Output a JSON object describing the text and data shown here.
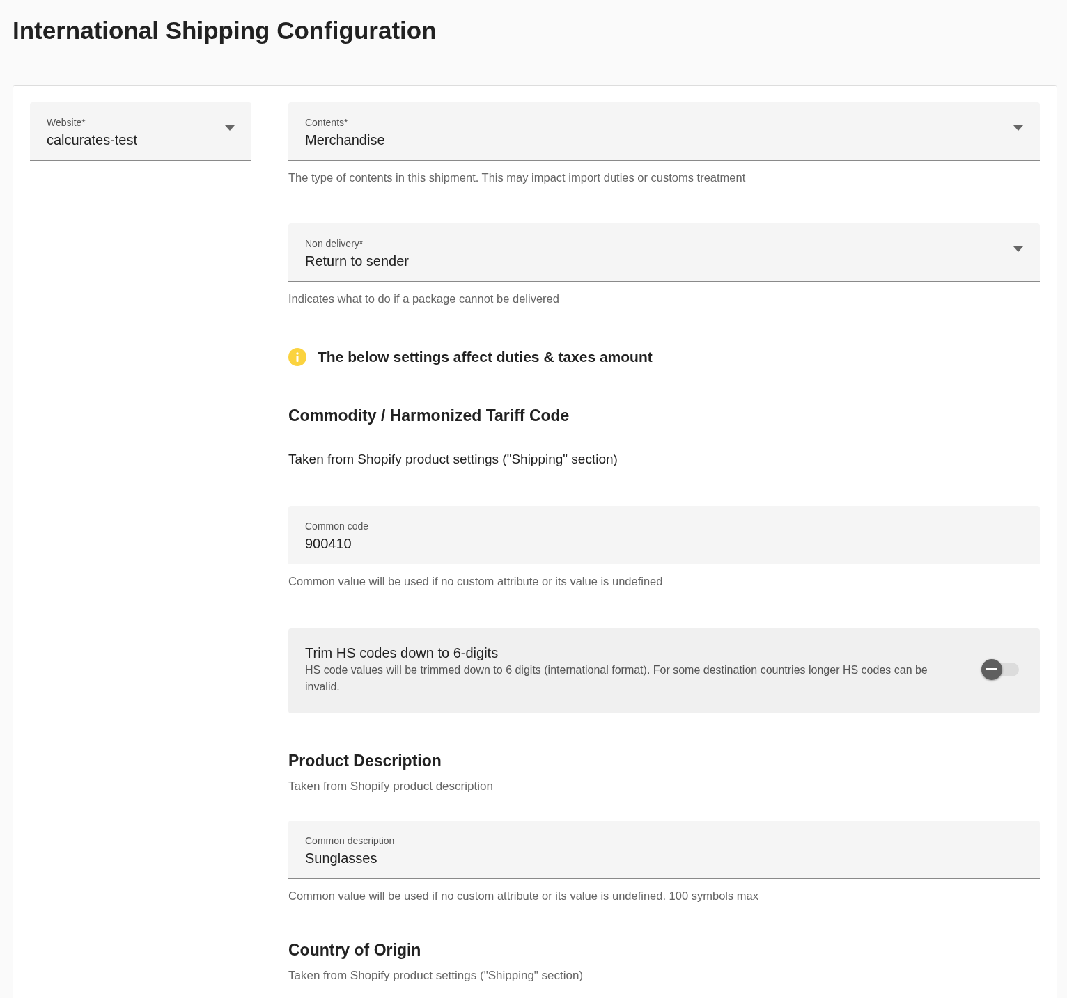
{
  "page": {
    "title": "International Shipping Configuration"
  },
  "website": {
    "label": "Website*",
    "value": "calcurates-test"
  },
  "items": [
    {
      "kind": "select",
      "label": "Contents*",
      "value": "Merchandise",
      "helper": "The type of contents in this shipment. This may impact import duties or customs treatment"
    },
    {
      "kind": "select",
      "label": "Non delivery*",
      "value": "Return to sender",
      "helper": "Indicates what to do if a package cannot be delivered"
    },
    {
      "kind": "notice",
      "text": "The below settings affect duties & taxes amount"
    },
    {
      "kind": "heading",
      "text": "Commodity / Harmonized Tariff Code"
    },
    {
      "kind": "text",
      "text": "Taken from Shopify product settings (\"Shipping\" section)"
    },
    {
      "kind": "input",
      "label": "Common code",
      "value": "900410",
      "helper": "Common value will be used if no custom attribute or its value is undefined"
    },
    {
      "kind": "toggle",
      "title": "Trim HS codes down to 6-digits",
      "description": "HS code values will be trimmed down to 6 digits (international format). For some destination countries longer HS codes can be invalid.",
      "on": false
    },
    {
      "kind": "heading",
      "text": "Product Description",
      "subtext": "Taken from Shopify product description"
    },
    {
      "kind": "input",
      "label": "Common description",
      "value": "Sunglasses",
      "helper": "Common value will be used if no custom attribute or its value is undefined. 100 symbols max"
    },
    {
      "kind": "heading",
      "text": "Country of Origin",
      "subtext": "Taken from Shopify product settings (\"Shipping\" section)"
    }
  ]
}
